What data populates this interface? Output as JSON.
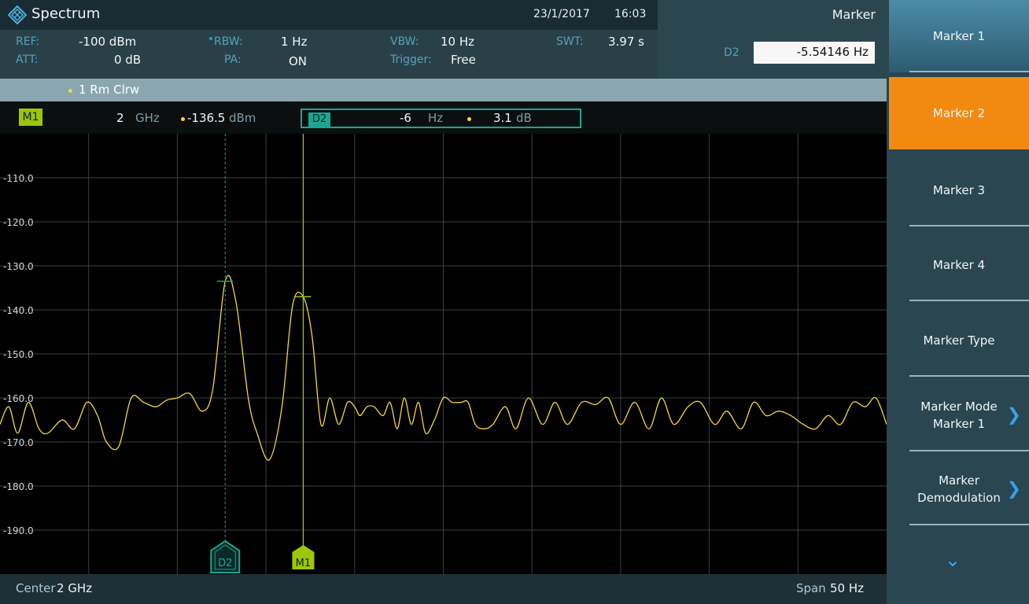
{
  "titlebar": {
    "app_title": "Spectrum",
    "date": "23/1/2017",
    "time": "16:03",
    "marker_menu_title": "Marker"
  },
  "params": {
    "ref_label": "REF:",
    "ref_value": "-100 dBm",
    "att_label": "ATT:",
    "att_value": "0 dB",
    "rbw_label": "RBW:",
    "rbw_value": "1 Hz",
    "pa_label": "PA:",
    "pa_value": "ON",
    "vbw_label": "VBW:",
    "vbw_value": "10 Hz",
    "trigger_label": "Trigger:",
    "trigger_value": "Free",
    "swt_label": "SWT:",
    "swt_value": "3.97 s",
    "d2_label": "D2",
    "d2_input_value": "-5.54146 Hz"
  },
  "trace": {
    "label": "1 Rm Clrw",
    "color": "#f6d544"
  },
  "markers": {
    "m1": {
      "tag": "M1",
      "freq": "2",
      "freq_unit": "GHz",
      "level": "-136.5",
      "level_unit": "dBm",
      "color": "#9bc70a"
    },
    "d2": {
      "tag": "D2",
      "freq": "-6",
      "freq_unit": "Hz",
      "level": "3.1",
      "level_unit": "dB",
      "color": "#1ba691"
    }
  },
  "chart_data": {
    "type": "line",
    "title": "",
    "xlabel": "",
    "ylabel": "",
    "center": "2 GHz",
    "span": "50 Hz",
    "x_range_hz": [
      -25,
      25
    ],
    "ylim": [
      -200,
      -100
    ],
    "y_ticks": [
      "-110.0",
      "-120.0",
      "-130.0",
      "-140.0",
      "-150.0",
      "-160.0",
      "-170.0",
      "-180.0",
      "-190.0"
    ],
    "grid": true,
    "series": [
      {
        "x": [
          -25,
          -24.5,
          -24,
          -23.4,
          -22.8,
          -22.3,
          -21.5,
          -20.8,
          -20.1,
          -19.5,
          -19,
          -18.3,
          -17.6,
          -16.9,
          -16.2,
          -15.6,
          -15,
          -14.3,
          -13.6,
          -13,
          -12.3,
          -11.7,
          -11,
          -10.5,
          -9.8,
          -9.1,
          -8.5,
          -7.9,
          -7.4,
          -6.9,
          -6.4,
          -5.9,
          -5.4,
          -5,
          -4.7,
          -4.3,
          -3.9,
          -3.4,
          -3,
          -2.6,
          -2.2,
          -1.8,
          -1.4,
          -1,
          -0.5,
          0,
          0.5,
          1,
          1.4,
          1.8,
          2.3,
          2.8,
          3.5,
          4.1,
          4.8,
          5.6,
          6.3,
          7,
          7.8,
          8.6,
          9.3,
          10,
          10.8,
          11.6,
          12.3,
          13,
          13.8,
          14.5,
          15.3,
          16,
          16.8,
          17.5,
          18.2,
          18.9,
          19.6,
          20.3,
          21,
          21.7,
          22.4,
          23.1,
          23.8,
          24.4,
          25
        ],
        "y": [
          -166,
          -162,
          -168,
          -161,
          -167,
          -168,
          -165,
          -167,
          -161,
          -164,
          -170,
          -171,
          -160,
          -161,
          -162,
          -160.5,
          -160,
          -159,
          -163,
          -158,
          -133.5,
          -138,
          -160,
          -168,
          -174,
          -162,
          -139,
          -137,
          -146,
          -166,
          -160,
          -166,
          -161,
          -162,
          -164,
          -162,
          -162,
          -164,
          -161,
          -167,
          -160,
          -166,
          -161,
          -168,
          -165,
          -160,
          -161,
          -161,
          -161,
          -166,
          -167,
          -166,
          -162,
          -167,
          -160,
          -166,
          -161,
          -166,
          -161,
          -161.5,
          -160,
          -166,
          -161,
          -167,
          -160,
          -166,
          -162,
          -161,
          -166,
          -163,
          -167,
          -161,
          -164,
          -163,
          -164,
          -166,
          -167,
          -164,
          -166,
          -161,
          -162,
          -160,
          -166
        ]
      }
    ]
  },
  "softkeys": [
    {
      "label": "Marker 1",
      "style": "blue"
    },
    {
      "label": "Marker 2",
      "style": "orange"
    },
    {
      "label": "Marker 3",
      "style": "dark"
    },
    {
      "label": "Marker 4",
      "style": "dark"
    },
    {
      "label": "Marker Type",
      "style": "dark"
    },
    {
      "label": "Marker Mode\nMarker 1",
      "style": "dark",
      "submenu": true
    },
    {
      "label": "Marker\nDemodulation",
      "style": "dark",
      "submenu": true
    }
  ]
}
